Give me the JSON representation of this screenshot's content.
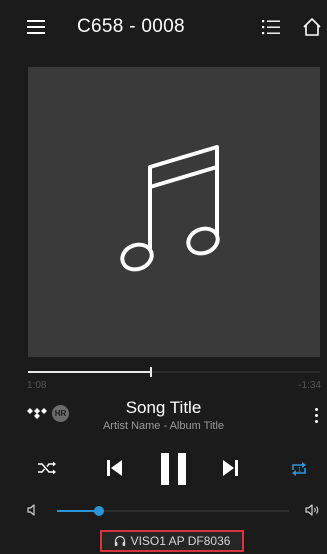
{
  "header": {
    "title": "C658 - 0008",
    "menu_icon": "hamburger-icon",
    "queue_icon": "list-icon",
    "home_icon": "home-icon"
  },
  "artwork": {
    "icon": "music-note-icon"
  },
  "progress": {
    "elapsed": "1:08",
    "remaining": "-1:34",
    "fraction": 0.42
  },
  "track": {
    "title": "Song Title",
    "subtitle": "Artist Name - Album Title",
    "source_icon": "tidal-icon",
    "quality_badge": "HR"
  },
  "controls": {
    "shuffle_icon": "shuffle-icon",
    "prev_icon": "skip-previous-icon",
    "play_state": "pause-icon",
    "next_icon": "skip-next-icon",
    "repeat_icon": "repeat-icon"
  },
  "volume": {
    "level": 0.18
  },
  "output_device": {
    "label": "VISO1 AP DF8036",
    "icon": "headphones-icon"
  },
  "colors": {
    "background": "#1b1b1b",
    "accent": "#2d94d6",
    "highlight_border": "#d8343c"
  }
}
